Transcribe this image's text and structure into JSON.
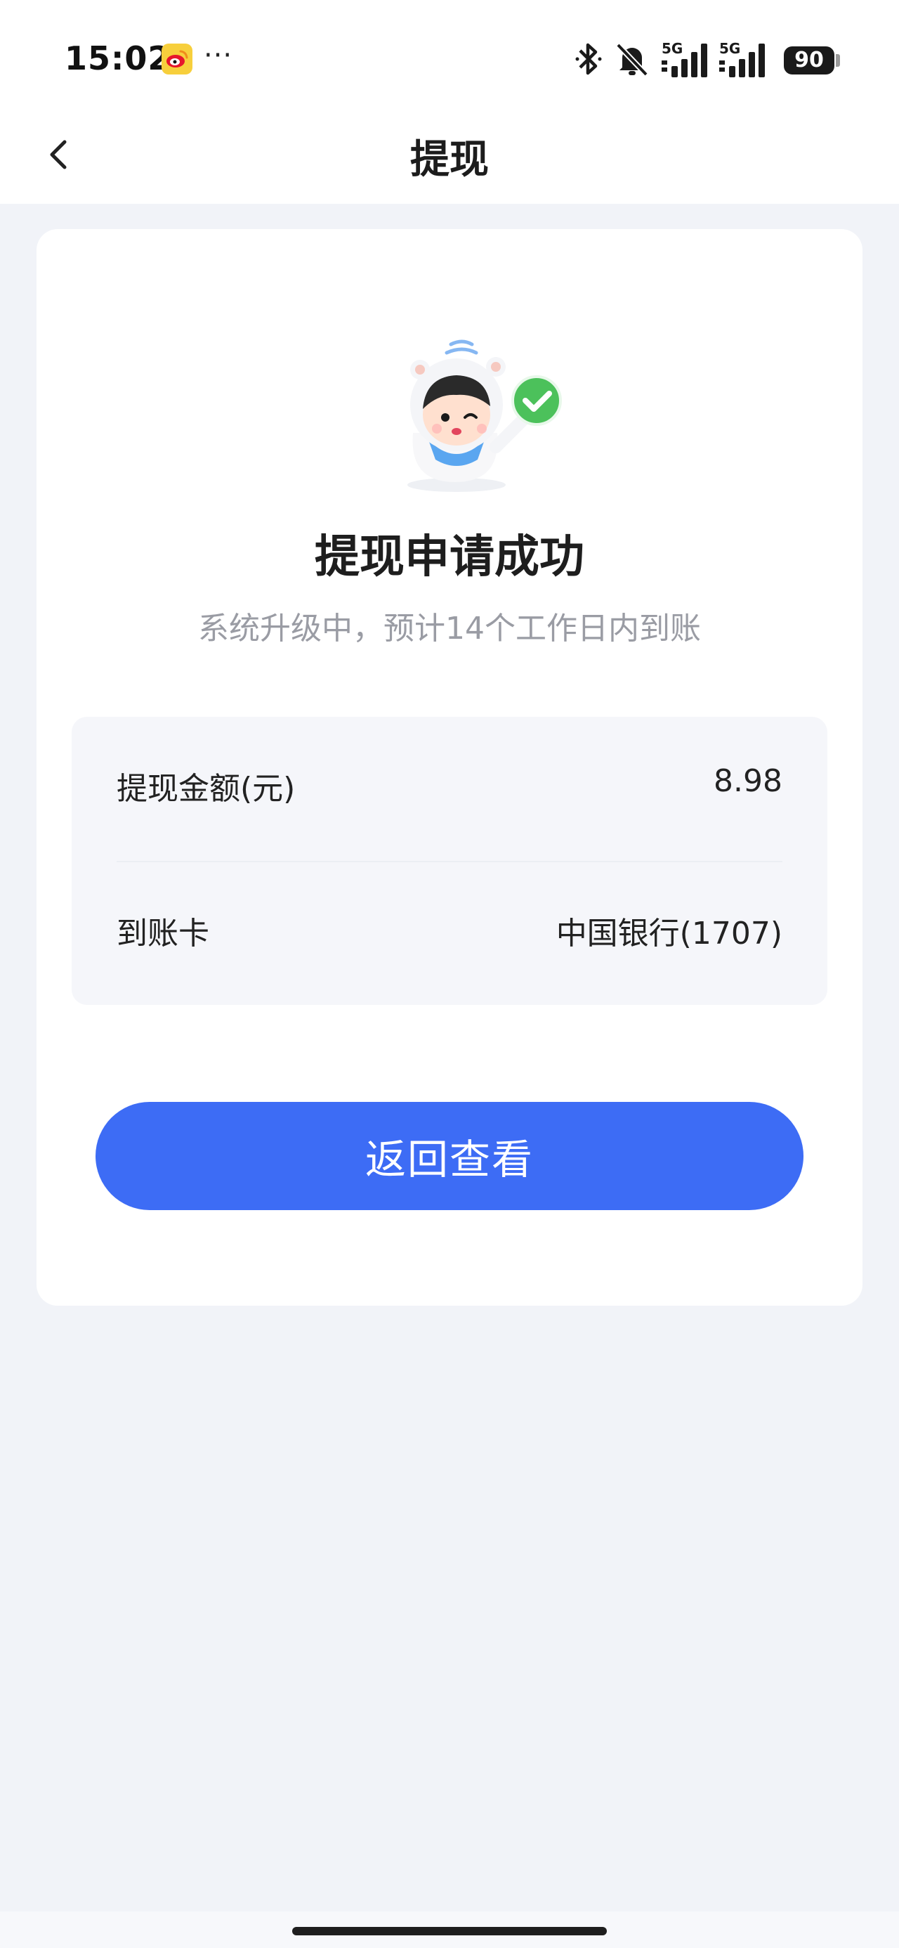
{
  "status_bar": {
    "time": "15:02",
    "dots": "···",
    "battery": "90",
    "icons": [
      "weibo-icon",
      "bluetooth-icon",
      "mute-icon",
      "signal-5g-icon",
      "signal-5g-icon"
    ]
  },
  "nav": {
    "title": "提现",
    "back_icon": "chevron-left-icon"
  },
  "result": {
    "title": "提现申请成功",
    "subtitle": "系统升级中，预计14个工作日内到账",
    "mascot_icon": "mascot-success-icon"
  },
  "details": {
    "amount_label": "提现金额(元)",
    "amount_value": "8.98",
    "card_label": "到账卡",
    "card_value": "中国银行(1707)"
  },
  "actions": {
    "back_view_label": "返回查看"
  },
  "colors": {
    "primary": "#3d6cf5",
    "background": "#f1f3f8",
    "success": "#4cc15b"
  }
}
